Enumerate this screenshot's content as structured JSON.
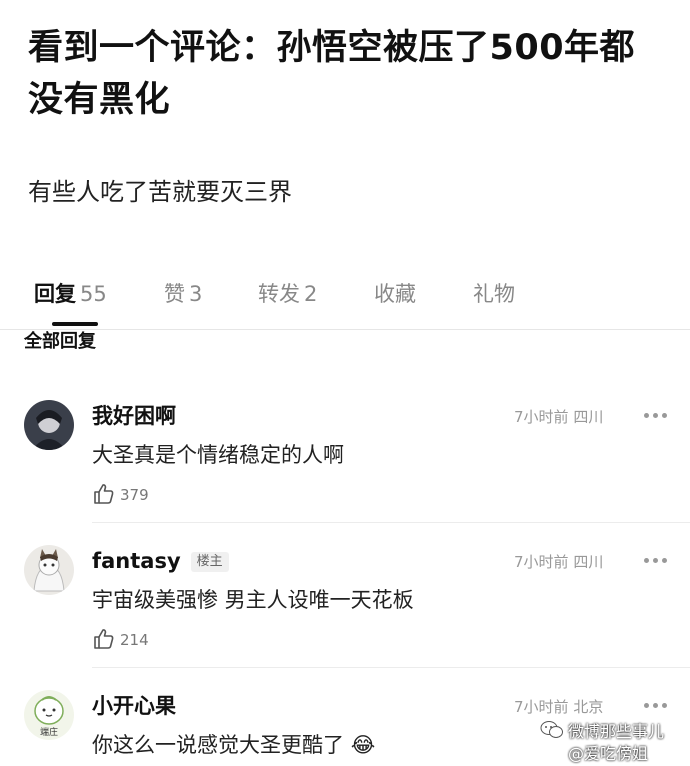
{
  "post": {
    "title": "看到一个评论：孙悟空被压了500年都没有黑化",
    "body": "有些人吃了苦就要灭三界"
  },
  "tabs": [
    {
      "label": "回复",
      "count": "55",
      "active": true
    },
    {
      "label": "赞",
      "count": "3",
      "active": false
    },
    {
      "label": "转发",
      "count": "2",
      "active": false
    },
    {
      "label": "收藏",
      "count": "",
      "active": false
    },
    {
      "label": "礼物",
      "count": "",
      "active": false
    }
  ],
  "section_label": "全部回复",
  "comments": [
    {
      "username": "我好困啊",
      "badge": "",
      "time": "7小时前",
      "location": "四川",
      "text": "大圣真是个情绪稳定的人啊",
      "likes": "379",
      "avatar": "dark-portrait-avatar"
    },
    {
      "username": "fantasy",
      "badge": "楼主",
      "time": "7小时前",
      "location": "四川",
      "text": "宇宙级美强惨 男主人设唯一天花板",
      "likes": "214",
      "avatar": "cat-avatar"
    },
    {
      "username": "小开心果",
      "badge": "",
      "time": "7小时前",
      "location": "北京",
      "text": "你这么一说感觉大圣更酷了",
      "emoji": "😂",
      "avatar": "cartoon-avatar",
      "avatar_caption": "端庄"
    }
  ],
  "watermark": {
    "line1": "微博那些事儿",
    "line2": "@爱吃傍姐"
  },
  "colors": {
    "text_primary": "#111111",
    "text_secondary": "#888888",
    "meta": "#999999",
    "divider": "#ececec"
  }
}
